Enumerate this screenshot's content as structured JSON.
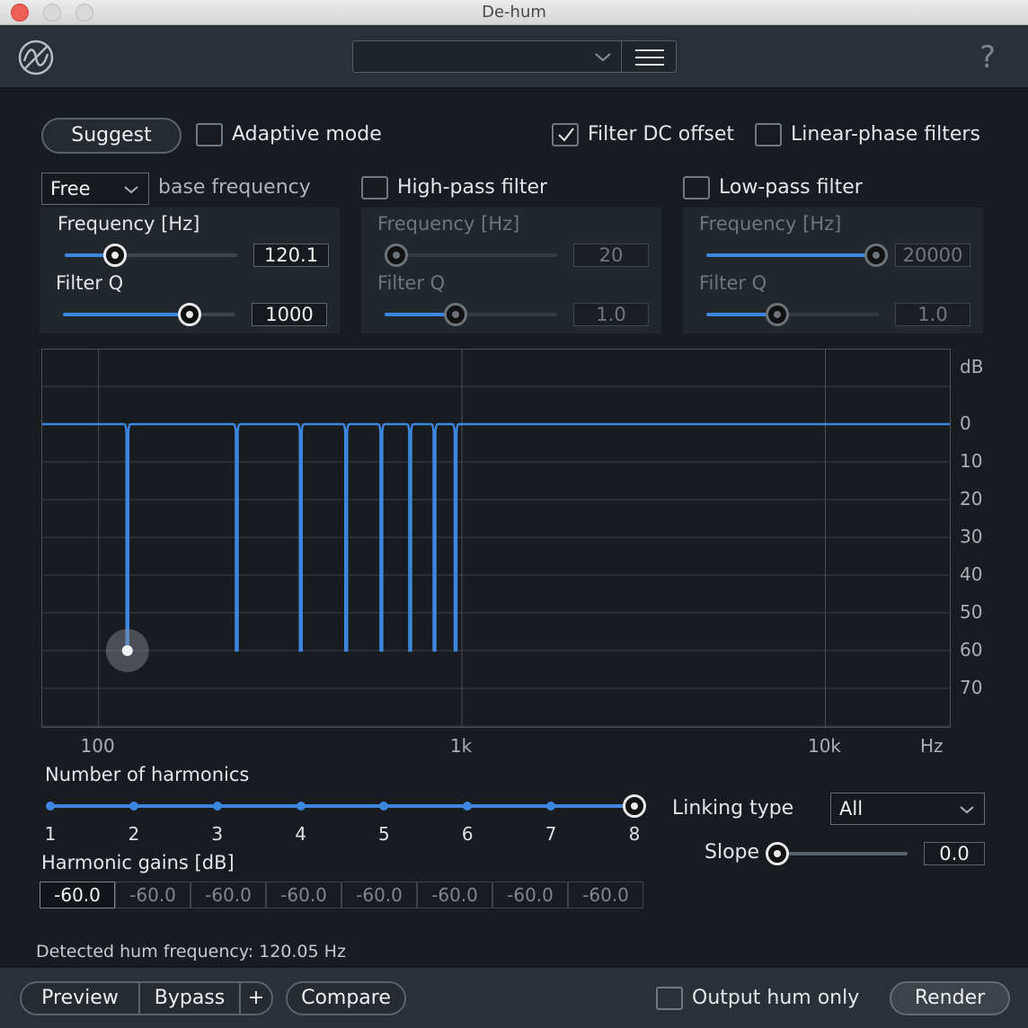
{
  "window": {
    "title": "De-hum"
  },
  "toolbar": {
    "preset_value": "",
    "help_label": "?"
  },
  "options": {
    "suggest_label": "Suggest",
    "adaptive_mode": {
      "label": "Adaptive mode",
      "checked": false
    },
    "filter_dc_offset": {
      "label": "Filter DC offset",
      "checked": true
    },
    "linear_phase": {
      "label": "Linear-phase filters",
      "checked": false
    }
  },
  "base": {
    "mode_value": "Free",
    "mode_caption": "base frequency",
    "frequency_label": "Frequency [Hz]",
    "frequency_value": "120.1",
    "frequency_fraction": 0.26,
    "q_label": "Filter Q",
    "q_value": "1000",
    "q_fraction": 0.77
  },
  "highpass": {
    "label": "High-pass filter",
    "checked": false,
    "frequency_label": "Frequency [Hz]",
    "frequency_value": "20",
    "frequency_fraction": 0.0,
    "q_label": "Filter Q",
    "q_value": "1.0",
    "q_fraction": 0.4
  },
  "lowpass": {
    "label": "Low-pass filter",
    "checked": false,
    "frequency_label": "Frequency [Hz]",
    "frequency_value": "20000",
    "frequency_fraction": 1.0,
    "q_label": "Filter Q",
    "q_value": "1.0",
    "q_fraction": 0.4
  },
  "graph": {
    "y_unit": "dB",
    "y_ticks": [
      "0",
      "10",
      "20",
      "30",
      "40",
      "50",
      "60",
      "70"
    ],
    "x_ticks": [
      "100",
      "1k",
      "10k"
    ],
    "x_unit": "Hz",
    "notch_frequencies_hz": [
      120.05,
      240.1,
      360.15,
      480.2,
      600.25,
      720.3,
      840.35,
      960.4
    ],
    "notch_depth_db": -60
  },
  "harmonics": {
    "label": "Number of harmonics",
    "values": [
      "1",
      "2",
      "3",
      "4",
      "5",
      "6",
      "7",
      "8"
    ],
    "selected": 8,
    "gains_label": "Harmonic gains [dB]",
    "gains": [
      "-60.0",
      "-60.0",
      "-60.0",
      "-60.0",
      "-60.0",
      "-60.0",
      "-60.0",
      "-60.0"
    ]
  },
  "linking": {
    "label": "Linking type",
    "value": "All",
    "slope_label": "Slope",
    "slope_value": "0.0"
  },
  "status": {
    "detected_text": "Detected hum frequency: 120.05 Hz"
  },
  "footer": {
    "preview_label": "Preview",
    "bypass_label": "Bypass",
    "plus_label": "+",
    "compare_label": "Compare",
    "output_hum_only": {
      "label": "Output hum only",
      "checked": false
    },
    "render_label": "Render"
  },
  "colors": {
    "accent": "#3d86e0",
    "background": "#181b1f",
    "panel": "#22272d"
  }
}
